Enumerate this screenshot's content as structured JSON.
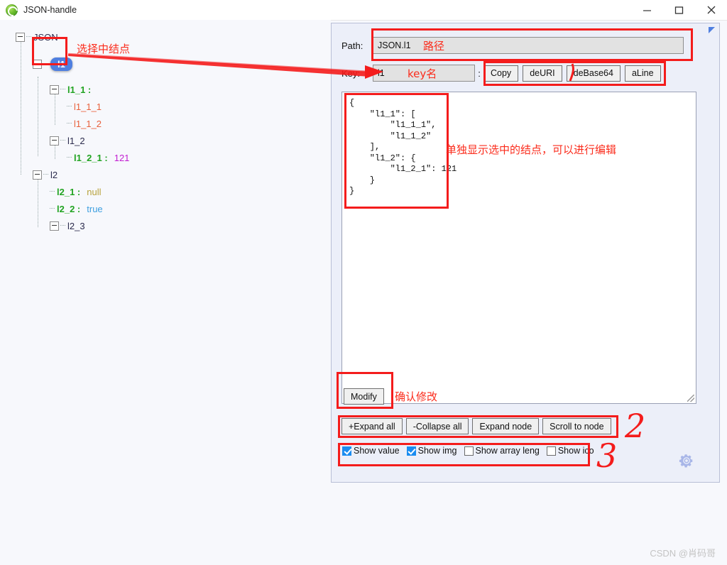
{
  "window": {
    "title": "JSON-handle",
    "icon": "browser-globe-icon",
    "minimize": "—",
    "maximize": "□",
    "close": "✕"
  },
  "tree": {
    "root_label": "JSON",
    "selected_node": "l1",
    "nodes": [
      {
        "label": "JSON",
        "value": "",
        "depth": 0
      },
      {
        "label": "l1",
        "value": "",
        "depth": 1,
        "selected": true
      },
      {
        "label": "l1_1",
        "value": "",
        "depth": 2,
        "colon": true
      },
      {
        "label": "l1_1_1",
        "value": "",
        "depth": 3
      },
      {
        "label": "l1_1_2",
        "value": "",
        "depth": 3
      },
      {
        "label": "l1_2",
        "value": "",
        "depth": 2
      },
      {
        "label": "l1_2_1",
        "value": "121",
        "depth": 3,
        "colon": true
      },
      {
        "label": "l2",
        "value": "",
        "depth": 1
      },
      {
        "label": "l2_1",
        "value": "null",
        "depth": 2,
        "colon": true
      },
      {
        "label": "l2_2",
        "value": "true",
        "depth": 2,
        "colon": true
      },
      {
        "label": "l2_3",
        "value": "",
        "depth": 2
      }
    ]
  },
  "panel": {
    "path_label": "Path:",
    "path_value": "JSON.l1",
    "key_label": "Key:",
    "key_value": "l1",
    "separator": ":",
    "buttons": [
      {
        "label": "Copy"
      },
      {
        "label": "deURI"
      },
      {
        "label": "deBase64"
      },
      {
        "label": "aLine"
      }
    ],
    "editor_text": "{\n    \"l1_1\": [\n        \"l1_1_1\",\n        \"l1_1_2\"\n    ],\n    \"l1_2\": {\n        \"l1_2_1\": 121\n    }\n}",
    "modify_label": "Modify",
    "node_buttons": [
      {
        "label": "+Expand all"
      },
      {
        "label": "-Collapse all"
      },
      {
        "label": "Expand node"
      },
      {
        "label": "Scroll to node"
      }
    ],
    "checkboxes": [
      {
        "label": "Show value",
        "checked": true
      },
      {
        "label": "Show img",
        "checked": true
      },
      {
        "label": "Show array leng",
        "checked": false
      },
      {
        "label": "Show ico",
        "checked": false
      }
    ],
    "settings_icon": "gear-icon",
    "collapse_indicator": "triangle-icon"
  },
  "annotations": {
    "selected_node_note": "选择中结点",
    "path_note": "路径",
    "key_note": "key名",
    "editor_note": "单独显示选中的结点，可以进行编辑",
    "modify_note": "确认修改",
    "mark_two": "2",
    "mark_three": "3"
  },
  "watermark": {
    "text": "CSDN @肖码哥"
  },
  "colors": {
    "accent": "#4f7fe0",
    "annotation": "#f41c1c",
    "key": "#21a321",
    "string": "#e8603c",
    "number": "#c21ed1",
    "null": "#b8a23c",
    "boolean": "#3fa0e0"
  }
}
